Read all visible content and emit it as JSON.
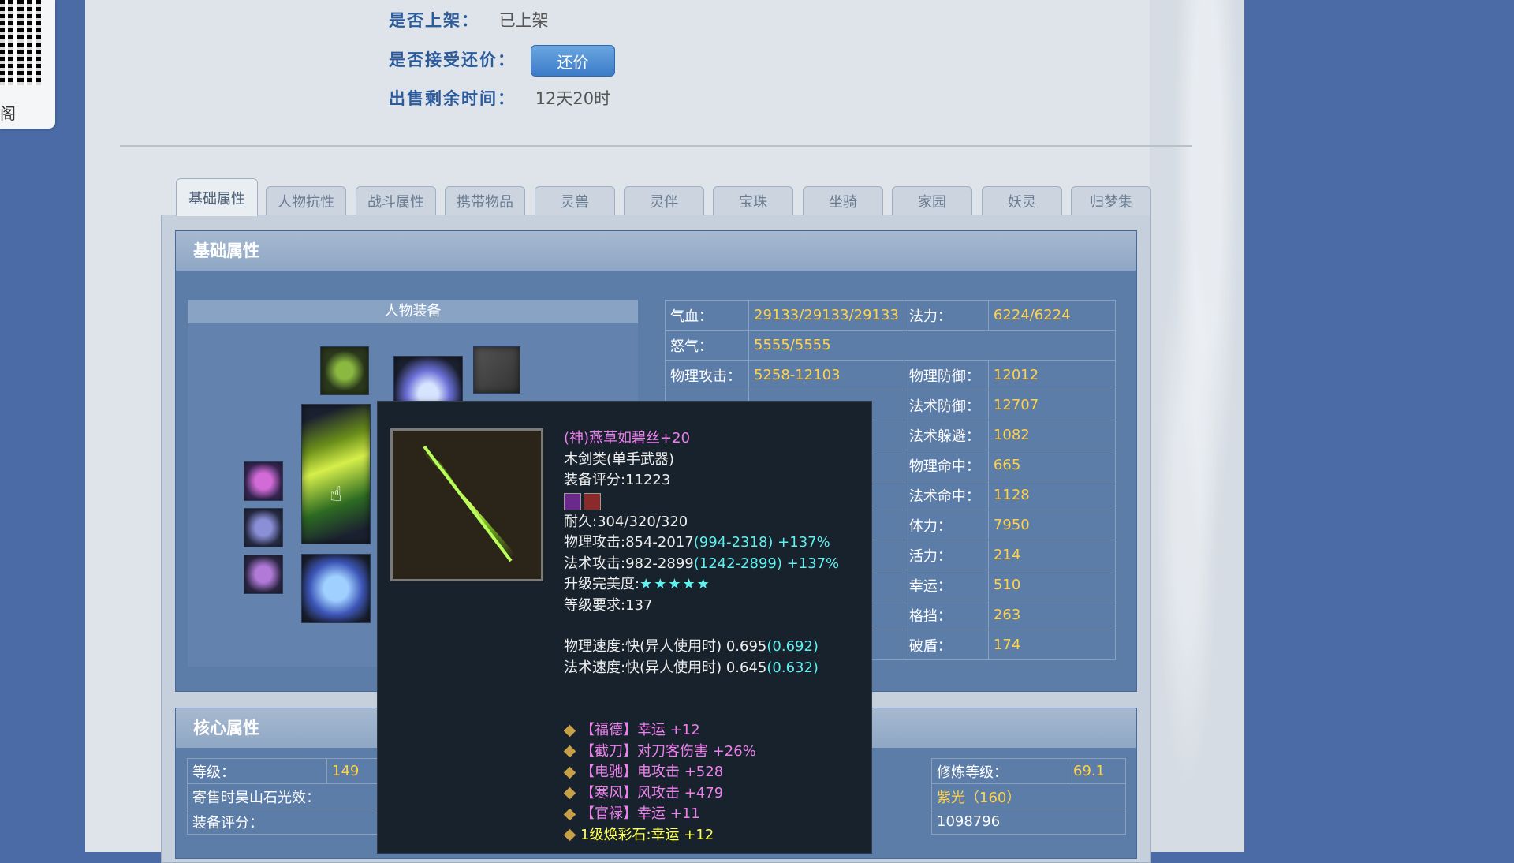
{
  "sidebar": {
    "qr_caption": "阁"
  },
  "info": {
    "listed_label": "是否上架：",
    "listed_value": "已上架",
    "counteroffer_label": "是否接受还价：",
    "counteroffer_button": "还价",
    "remaining_label": "出售剩余时间：",
    "remaining_value": "12天20时"
  },
  "tabs": [
    {
      "label": "基础属性",
      "active": true
    },
    {
      "label": "人物抗性"
    },
    {
      "label": "战斗属性"
    },
    {
      "label": "携带物品"
    },
    {
      "label": "灵兽"
    },
    {
      "label": "灵伴"
    },
    {
      "label": "宝珠"
    },
    {
      "label": "坐骑"
    },
    {
      "label": "家园"
    },
    {
      "label": "妖灵"
    },
    {
      "label": "归梦集"
    }
  ],
  "basic_section": {
    "title": "基础属性",
    "equipment_title": "人物装备"
  },
  "stats": {
    "hp_label": "气血：",
    "hp_value": "29133/29133/29133",
    "mp_label": "法力：",
    "mp_value": "6224/6224",
    "rage_label": "怒气：",
    "rage_value": "5555/5555",
    "patk_label": "物理攻击：",
    "patk_value": "5258-12103",
    "pdef_label": "物理防御：",
    "pdef_value": "12012",
    "mdef_label": "法术防御：",
    "mdef_value": "12707",
    "mdodge_label": "法术躲避：",
    "mdodge_value": "1082",
    "phit_label": "物理命中：",
    "phit_value": "665",
    "mhit_label": "法术命中：",
    "mhit_value": "1128",
    "con_label": "体力：",
    "con_value": "7950",
    "vit_label": "活力：",
    "vit_value": "214",
    "luck_label": "幸运：",
    "luck_value": "510",
    "block_label": "格挡：",
    "block_value": "263",
    "shieldbreak_label": "破盾：",
    "shieldbreak_value": "174"
  },
  "tooltip": {
    "name": "(神)燕草如碧丝+20",
    "type": "木剑类(单手武器)",
    "score": "装备评分:11223",
    "durability": "耐久:304/320/320",
    "patk_base": "物理攻击:854-2017",
    "patk_bonus": "(994-2318) +137%",
    "matk_base": "法术攻击:982-2899",
    "matk_bonus": "(1242-2899) +137%",
    "upgrade_label": "升级完美度:",
    "upgrade_stars": "★★★★★",
    "level_req": "等级要求:137",
    "pspeed_base": "物理速度:快(异人使用时) 0.695",
    "pspeed_bonus": "(0.692)",
    "mspeed_base": "法术速度:快(异人使用时) 0.645",
    "mspeed_bonus": "(0.632)",
    "affixes": [
      {
        "text": "【福德】幸运 +12",
        "color": "purple"
      },
      {
        "text": "【截刀】对刀客伤害 +26%",
        "color": "purple"
      },
      {
        "text": "【电驰】电攻击 +528",
        "color": "purple"
      },
      {
        "text": "【寒风】风攻击 +479",
        "color": "purple"
      },
      {
        "text": "【官禄】幸运 +11",
        "color": "purple"
      },
      {
        "text": "1级焕彩石:幸运 +12",
        "color": "yellow"
      }
    ]
  },
  "core_section": {
    "title": "核心属性",
    "level_label": "等级：",
    "level_value": "149",
    "consign_label": "寄售时昊山石光效：",
    "score_label": "装备评分：",
    "cultivation_label": "修炼等级：",
    "cultivation_value": "69.1",
    "glow_value": "紫光（160）",
    "score_value": "1098796"
  },
  "colors": {
    "background": "#4a6ba5",
    "value_yellow": "#ffd24a",
    "label_blue": "#2c5b9c",
    "tooltip_purple": "#ee80ee",
    "tooltip_cyan": "#5ff0f0"
  }
}
